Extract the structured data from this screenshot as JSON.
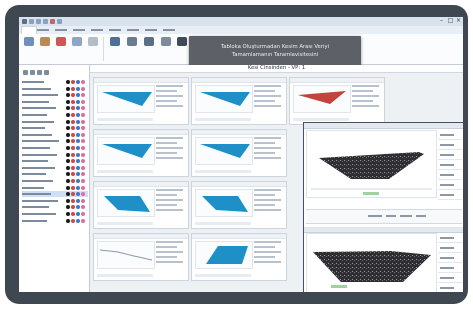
{
  "tooltip": {
    "line1": "Tabloka Oluşturmadan Kesim Arası Veriyi",
    "line2": "Tamamlamanın Taramlavisitesini"
  },
  "main": {
    "title": "Kesi Cinsinden - VP: 1"
  },
  "colors": {
    "device_frame": "#3f4750",
    "fill_blue": "#1f8fc8",
    "fill_red": "#c2443c",
    "tooltip_bg": "#5d6066",
    "highlight": "#cfe0f4"
  },
  "icons": {
    "ribbon_buttons": [
      "table-icon",
      "paste-icon",
      "cut-icon",
      "chart-icon",
      "align-icon",
      "measure-icon",
      "flag-icon",
      "pen-icon"
    ],
    "left_dots": [
      "black",
      "red",
      "blue",
      "pink"
    ]
  },
  "grid": {
    "rows": 4,
    "cols": 3
  }
}
